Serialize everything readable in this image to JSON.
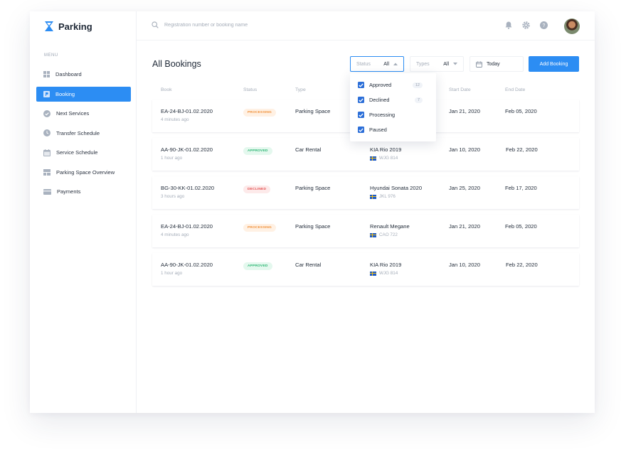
{
  "app": {
    "name": "Parking"
  },
  "sidebar": {
    "menu_label": "MENU",
    "items": [
      {
        "label": "Dashboard",
        "icon": "grid-icon"
      },
      {
        "label": "Booking",
        "icon": "parking-icon",
        "active": true
      },
      {
        "label": "Next Services",
        "icon": "check-circle-icon"
      },
      {
        "label": "Transfer Schedule",
        "icon": "clock-icon"
      },
      {
        "label": "Service Schedule",
        "icon": "calendar-icon"
      },
      {
        "label": "Parking Space Overview",
        "icon": "layout-icon"
      },
      {
        "label": "Payments",
        "icon": "credit-card-icon"
      }
    ]
  },
  "search": {
    "placeholder": "Registration number or booking name"
  },
  "main": {
    "title": "All Bookings",
    "filters": {
      "status": {
        "label": "Status",
        "value": "All"
      },
      "types": {
        "label": "Types",
        "value": "All"
      },
      "date": {
        "value": "Today"
      }
    },
    "add_button": "Add Booking",
    "columns": [
      "Book",
      "Status",
      "Type",
      "Start Date",
      "End Date"
    ],
    "rows": [
      {
        "book": "EA-24-BJ-01.02.2020",
        "time": "4 minutes ago",
        "status": "PROCESSING",
        "status_kind": "processing",
        "type": "Parking Space",
        "vehicle": "",
        "plate": "",
        "start": "Jan 21, 2020",
        "end": "Feb 05, 2020"
      },
      {
        "book": "AA-90-JK-01.02.2020",
        "time": "1 hour ago",
        "status": "APPROVED",
        "status_kind": "approved",
        "type": "Car Rental",
        "vehicle": "KIA Rio 2019",
        "plate": "WJG 814",
        "start": "Jan 10, 2020",
        "end": "Feb 22, 2020"
      },
      {
        "book": "BG-30-KK-01.02.2020",
        "time": "3 hours ago",
        "status": "DECLINED",
        "status_kind": "declined",
        "type": "Parking Space",
        "vehicle": "Hyundai Sonata 2020",
        "plate": "JKL 976",
        "start": "Jan 25, 2020",
        "end": "Feb 17, 2020"
      },
      {
        "book": "EA-24-BJ-01.02.2020",
        "time": "4 minutes ago",
        "status": "PROCESSING",
        "status_kind": "processing",
        "type": "Parking Space",
        "vehicle": "Renault Megane",
        "plate": "CAO 722",
        "start": "Jan 21, 2020",
        "end": "Feb 05, 2020"
      },
      {
        "book": "AA-90-JK-01.02.2020",
        "time": "1 hour ago",
        "status": "APPROVED",
        "status_kind": "approved",
        "type": "Car Rental",
        "vehicle": "KIA Rio 2019",
        "plate": "WJG 814",
        "start": "Jan 10, 2020",
        "end": "Feb 22, 2020"
      }
    ]
  },
  "status_dropdown": {
    "options": [
      {
        "label": "Approved",
        "count": "12",
        "checked": true
      },
      {
        "label": "Declined",
        "count": "7",
        "checked": true
      },
      {
        "label": "Processing",
        "count": "",
        "checked": true
      },
      {
        "label": "Paused",
        "count": "",
        "checked": true
      }
    ]
  },
  "colors": {
    "accent": "#2c8df3",
    "processing": "#f0913b",
    "approved": "#2bb673",
    "declined": "#e45353"
  }
}
